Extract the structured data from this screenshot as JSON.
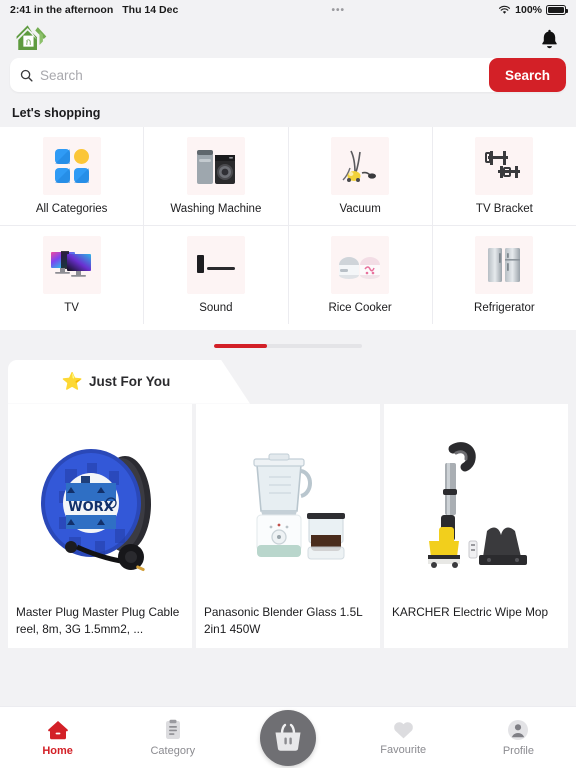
{
  "statusbar": {
    "time": "2:41 in the afternoon",
    "date": "Thu 14 Dec",
    "dots": "•••",
    "battery_percent": "100%",
    "wifi_icon": "wifi-icon",
    "battery_icon": "battery-icon"
  },
  "header": {
    "logo_icon": "home-brand-logo-icon",
    "notification_icon": "bell-icon"
  },
  "search": {
    "placeholder": "Search",
    "value": "",
    "button_label": "Search",
    "icon": "search-icon",
    "button_color": "#d32027"
  },
  "sections": {
    "shopping_title": "Let's shopping"
  },
  "categories": [
    {
      "label": "All Categories",
      "icon": "grid-squares-icon"
    },
    {
      "label": "Washing Machine",
      "icon": "washing-machine-icon"
    },
    {
      "label": "Vacuum",
      "icon": "vacuum-cleaner-icon"
    },
    {
      "label": "TV Bracket",
      "icon": "tv-bracket-icon"
    },
    {
      "label": "TV",
      "icon": "television-icon"
    },
    {
      "label": "Sound",
      "icon": "soundbar-icon"
    },
    {
      "label": "Rice Cooker",
      "icon": "rice-cooker-icon"
    },
    {
      "label": "Refrigerator",
      "icon": "refrigerator-icon"
    }
  ],
  "pager": {
    "active_color": "#d32027",
    "track_color": "#e4e4e7",
    "progress_percent": 36
  },
  "just_for_you": {
    "label": "Just For You",
    "star_icon": "⭐"
  },
  "products": [
    {
      "title": "Master Plug Master Plug Cable reel, 8m, 3G 1.5mm2, ...",
      "image": "cable-reel-product-image"
    },
    {
      "title": "Panasonic Blender Glass 1.5L 2in1 450W",
      "image": "blender-product-image"
    },
    {
      "title": "KARCHER Electric Wipe Mop",
      "image": "electric-mop-product-image"
    }
  ],
  "tabbar": {
    "items": [
      {
        "label": "Home",
        "icon": "home-icon",
        "active": true
      },
      {
        "label": "Category",
        "icon": "list-icon",
        "active": false
      },
      {
        "label": "Favourite",
        "icon": "heart-icon",
        "active": false
      },
      {
        "label": "Profile",
        "icon": "person-icon",
        "active": false
      }
    ],
    "cart": {
      "icon": "shopping-basket-icon"
    },
    "active_color": "#d32027",
    "inactive_color": "#8b8b90"
  }
}
